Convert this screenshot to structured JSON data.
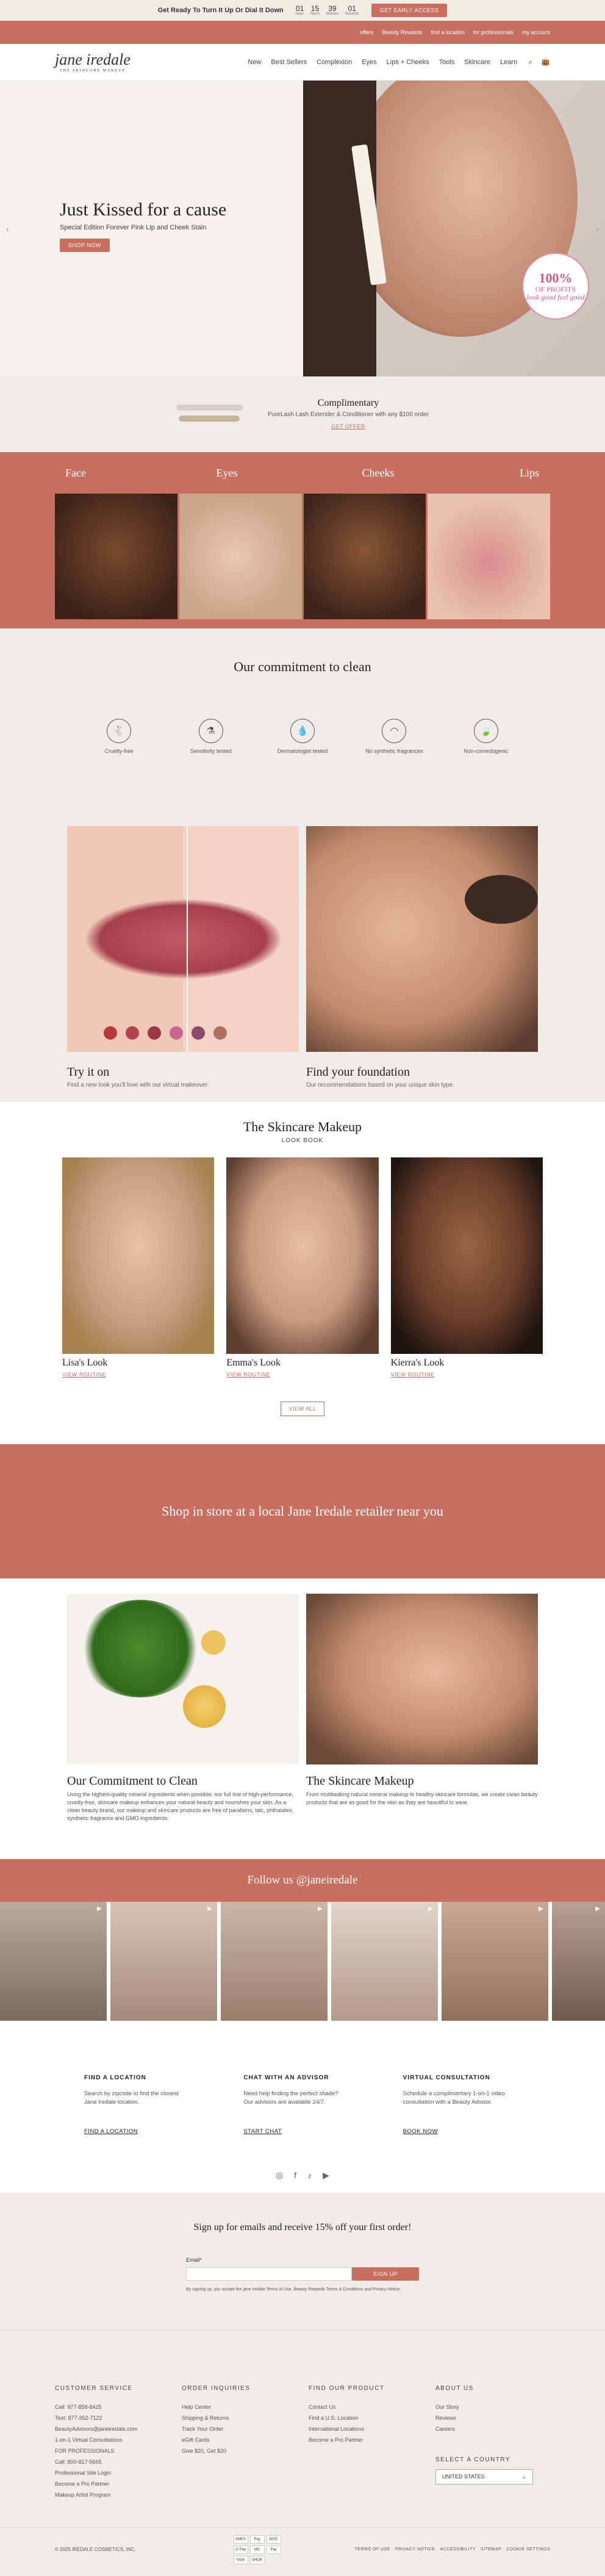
{
  "promo": {
    "text": "Get Ready To Turn It Up Or Dial It Down",
    "timer": [
      {
        "v": "01",
        "l": "Days"
      },
      {
        "v": "15",
        "l": "Hours"
      },
      {
        "v": "39",
        "l": "Minutes"
      },
      {
        "v": "01",
        "l": "Seconds"
      }
    ],
    "cta": "GET EARLY ACCESS"
  },
  "util": [
    "offers",
    "Beauty Rewards",
    "find a location",
    "for professionals",
    "my account"
  ],
  "nav": {
    "logo": "jane iredale",
    "logo_sub": "THE SKINCARE MAKEUP",
    "items": [
      "New",
      "Best Sellers",
      "Complexion",
      "Eyes",
      "Lips + Cheeks",
      "Tools",
      "Skincare",
      "Learn"
    ]
  },
  "hero": {
    "title": "Just Kissed for a cause",
    "subtitle": "Special Edition Forever Pink Lip and Cheek Stain",
    "cta": "SHOP NOW",
    "badge_big": "100%",
    "badge_small": "OF PROFITS",
    "badge_script": "look good feel good",
    "arrow_left": "‹",
    "arrow_right": "›"
  },
  "comp": {
    "title": "Complimentary",
    "text": "PureLash Lash Extender & Conditioner with any $100 order",
    "cta": "GET OFFER"
  },
  "categories": [
    "Face",
    "Eyes",
    "Cheeks",
    "Lips"
  ],
  "commit": {
    "title": "Our commitment to clean",
    "icons": [
      {
        "label": "Cruelty-free",
        "icon": "rabbit-icon"
      },
      {
        "label": "Sensitivity tested",
        "icon": "flask-icon"
      },
      {
        "label": "Dermatologist tested",
        "icon": "drop-icon"
      },
      {
        "label": "No synthetic fragrances",
        "icon": "nose-icon"
      },
      {
        "label": "Non-comedogenic",
        "icon": "leaf-icon"
      }
    ]
  },
  "try": {
    "title": "Try it on",
    "text": "Find a new look you'll love with our virtual makeover.",
    "swatches": [
      "#b73a3a",
      "#b5424f",
      "#9c3847",
      "#c8678a",
      "#8a4a6a",
      "#b07060"
    ]
  },
  "found": {
    "title": "Find your foundation",
    "text": "Our recommendations based on your unique skin type."
  },
  "look": {
    "title": "The Skincare Makeup",
    "sub": "LOOK BOOK",
    "items": [
      {
        "name": "Lisa's Look",
        "cta": "VIEW ROUTINE"
      },
      {
        "name": "Emma's Look",
        "cta": "VIEW ROUTINE"
      },
      {
        "name": "Kierra's Look",
        "cta": "VIEW ROUTINE"
      }
    ],
    "view_all": "VIEW ALL"
  },
  "store": "Shop in store at a local Jane Iredale retailer near you",
  "clean": {
    "title": "Our Commitment to Clean",
    "text": "Using the highest-quality mineral ingredients when possible, our full line of high-performance, cruelty-free, skincare makeup enhances your natural beauty and nourishes your skin. As a clean beauty brand, our makeup and skincare products are free of parabens, talc, phthalates, synthetic fragrance and GMO ingredients."
  },
  "skin": {
    "title": "The Skincare Makeup",
    "text": "From multitasking natural mineral makeup to healthy skincare formulas, we create clean beauty products that are as good for the skin as they are beautiful to wear."
  },
  "follow": "Follow us @janeiredale",
  "contact": [
    {
      "title": "FIND A LOCATION",
      "text": "Search by zipcode to find the closest Jane Iredale location.",
      "cta": "FIND A LOCATION"
    },
    {
      "title": "CHAT WITH AN ADVISOR",
      "text": "Need help finding the perfect shade? Our advisors are available 24/7.",
      "cta": "START CHAT"
    },
    {
      "title": "VIRTUAL CONSULTATION",
      "text": "Schedule a complimentary 1-on-1 video consultation with a Beauty Advisor.",
      "cta": "BOOK NOW"
    }
  ],
  "news": {
    "title": "Sign up for emails and receive 15% off your first order!",
    "label": "Email*",
    "cta": "SIGN UP",
    "legal": "By signing up, you accept the jane iredale Terms of Use, Beauty Rewards Terms & Conditions and Privacy Notice."
  },
  "footer": {
    "cols": [
      {
        "title": "CUSTOMER SERVICE",
        "items": [
          "Call: 877-858-8425",
          "Text: 877-352-7122",
          "BeautyAdvisors@janeiredale.com",
          "1-on-1 Virtual Consultations",
          "FOR PROFESSIONALS",
          "Call: 800-817-5665",
          "Professional Site Login",
          "Become a Pro Partner",
          "Makeup Artist Program"
        ]
      },
      {
        "title": "ORDER INQUIRIES",
        "items": [
          "Help Center",
          "Shipping & Returns",
          "Track Your Order",
          "eGift Cards",
          "Give $20, Get $20"
        ]
      },
      {
        "title": "FIND OUR PRODUCT",
        "items": [
          "Contact Us",
          "Find a U.S. Location",
          "International Locations",
          "Become a Pro Partner"
        ]
      },
      {
        "title": "ABOUT US",
        "items": [
          "Our Story",
          "Reviews",
          "Careers"
        ]
      }
    ],
    "country_label": "SELECT A COUNTRY",
    "country": "UNITED STATES",
    "copy": "© 2025 IREDALE COSMETICS, INC.",
    "pay": [
      "AMEX",
      "Pay",
      "DISC",
      "G Pay",
      "MC",
      "Pay",
      "VISA",
      "SHOP"
    ],
    "links": [
      "TERMS OF USE",
      "PRIVACY NOTICE",
      "ACCESSIBILITY",
      "SITEMAP",
      "COOKIE SETTINGS"
    ]
  }
}
